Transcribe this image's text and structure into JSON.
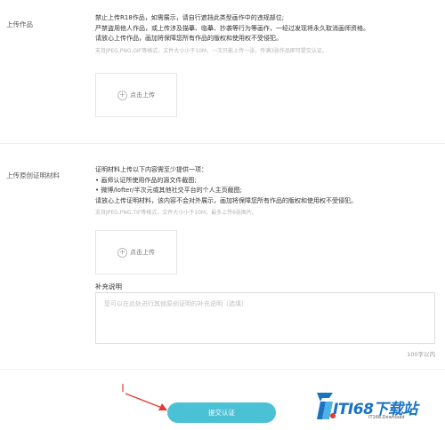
{
  "upload_works": {
    "label": "上传作品",
    "notice_lines": [
      "禁止上传R18作品，如需展示，请自行遮挡此类型画作中的违规部位;",
      "严禁盗用他人作品，或上传涉及描摹、临摹、抄袭等行为等画作，一经过发现将永久取消画师资格。",
      "请放心上传作品，画加将保障您所有作品的版权和使用权不受侵犯。"
    ],
    "hint": "支持JPEG,PNG,GIF等格式，文件大小小于10M，一次只能上传一张，传满3张作品即可提交认证。",
    "upload_button": "点击上传"
  },
  "upload_proof": {
    "label": "上传原创证明材料",
    "notice_lines": [
      "证明材料上传以下内容需至少提供一项：",
      "• 画师认证所使用作品的源文件截图;",
      "• 微博/lofter/半次元或其他社交平台的个人主页截图;",
      "请放心上传证明材料，该内容不会对外展示，画加将保障您所有作品的版权和使用权不受侵犯。"
    ],
    "hint": "支持JPEG,PNG,TIF等格式，文件大小小于10M，最多上传6张图片。",
    "upload_button": "点击上传"
  },
  "supplement": {
    "label": "补充说明",
    "placeholder": "您可以在此处进行其他原创证明的补充说明（选填）",
    "char_limit": "100字以内"
  },
  "submit": {
    "label": "提交认证"
  },
  "watermark": {
    "brand": "ITI68下载站",
    "sub": "IT168.Download"
  },
  "colors": {
    "accent": "#4bc1d6",
    "annotation_arrow": "#e53935",
    "watermark_blue": "#1a73c2"
  }
}
